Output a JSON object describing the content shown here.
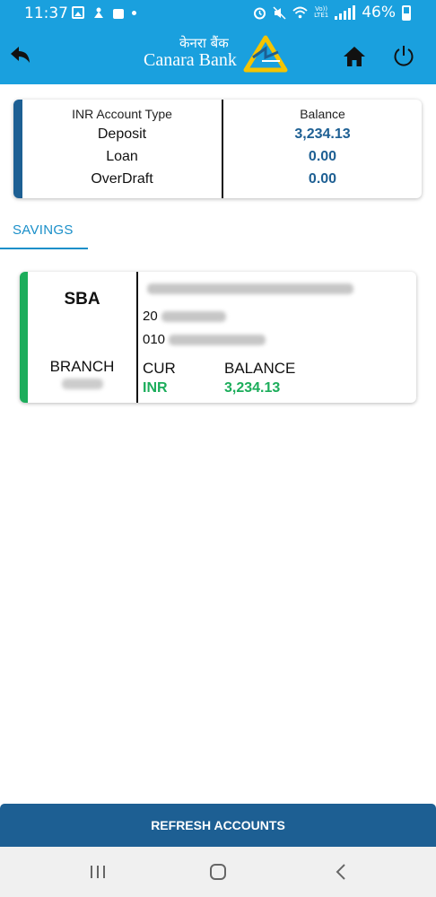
{
  "status_bar": {
    "time": "11:37",
    "battery": "46%",
    "volte_top": "Vo))",
    "volte_bottom": "LTE1"
  },
  "header": {
    "logo_hindi": "केनरा बैंक",
    "logo_english": "Canara Bank",
    "back_icon": "back-arrow-icon",
    "home_icon": "home-icon",
    "power_icon": "power-icon"
  },
  "summary": {
    "left_header": "INR Account Type",
    "right_header": "Balance",
    "rows": [
      {
        "type": "Deposit",
        "balance": "3,234.13"
      },
      {
        "type": "Loan",
        "balance": "0.00"
      },
      {
        "type": "OverDraft",
        "balance": "0.00"
      }
    ]
  },
  "tabs": [
    {
      "label": "SAVINGS",
      "active": true
    }
  ],
  "account": {
    "type": "SBA",
    "branch_label": "BRANCH",
    "number_prefix_1": "20",
    "number_prefix_2": "010",
    "cur_label": "CUR",
    "balance_label": "BALANCE",
    "currency": "INR",
    "balance": "3,234.13"
  },
  "refresh_button": "REFRESH ACCOUNTS",
  "colors": {
    "header_bg": "#1aa0de",
    "primary_dark": "#1d5f93",
    "savings_green": "#1cad5b",
    "tab_blue": "#1a8fc9",
    "logo_yellow": "#f5c400"
  }
}
